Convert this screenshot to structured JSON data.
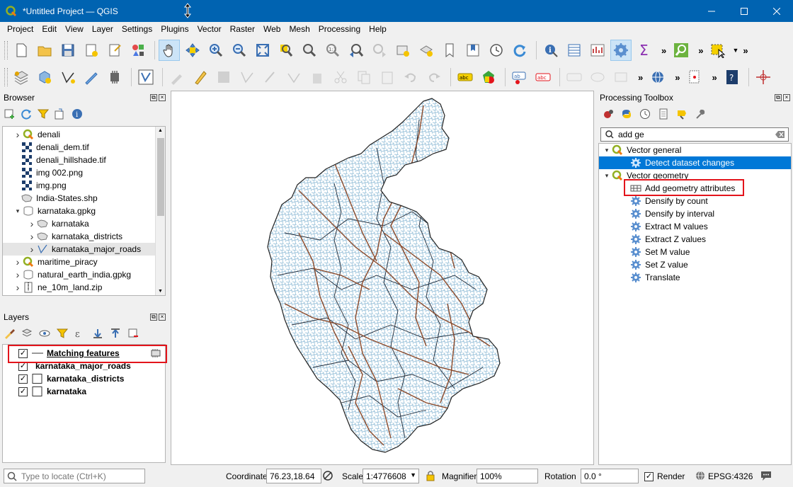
{
  "window": {
    "title": "*Untitled Project — QGIS"
  },
  "menu": [
    "Project",
    "Edit",
    "View",
    "Layer",
    "Settings",
    "Plugins",
    "Vector",
    "Raster",
    "Web",
    "Mesh",
    "Processing",
    "Help"
  ],
  "browser": {
    "title": "Browser",
    "items": [
      {
        "label": "denali",
        "icon": "qgis-project-icon",
        "expand": "right"
      },
      {
        "label": "denali_dem.tif",
        "icon": "raster-icon",
        "expand": ""
      },
      {
        "label": "denali_hillshade.tif",
        "icon": "raster-icon",
        "expand": ""
      },
      {
        "label": "img 002.png",
        "icon": "raster-icon",
        "expand": ""
      },
      {
        "label": "img.png",
        "icon": "raster-icon",
        "expand": ""
      },
      {
        "label": "India-States.shp",
        "icon": "polygon-layer-icon",
        "expand": ""
      },
      {
        "label": "karnataka.gpkg",
        "icon": "database-icon",
        "expand": "down"
      },
      {
        "label": "karnataka",
        "icon": "polygon-layer-icon",
        "expand": "right"
      },
      {
        "label": "karnataka_districts",
        "icon": "polygon-layer-icon",
        "expand": "right"
      },
      {
        "label": "karnataka_major_roads",
        "icon": "line-layer-icon",
        "expand": "right"
      },
      {
        "label": "maritime_piracy",
        "icon": "qgis-project-icon",
        "expand": "right"
      },
      {
        "label": "natural_earth_india.gpkg",
        "icon": "database-icon",
        "expand": "right"
      },
      {
        "label": "ne_10m_land.zip",
        "icon": "zip-icon",
        "expand": "right"
      }
    ]
  },
  "layers": {
    "title": "Layers",
    "items": [
      {
        "label": "Matching features",
        "checked": true
      },
      {
        "label": "karnataka_major_roads",
        "checked": true
      },
      {
        "label": "karnataka_districts",
        "checked": true
      },
      {
        "label": "karnataka",
        "checked": true
      }
    ]
  },
  "toolbox": {
    "title": "Processing Toolbox",
    "search_value": "add ge",
    "groups": [
      {
        "label": "Vector general",
        "items": [
          "Detect dataset changes"
        ]
      },
      {
        "label": "Vector geometry",
        "items": [
          "Add geometry attributes",
          "Densify by count",
          "Densify by interval",
          "Extract M values",
          "Extract Z values",
          "Set M value",
          "Set Z value",
          "Translate"
        ]
      }
    ]
  },
  "status": {
    "locate_placeholder": "Type to locate (Ctrl+K)",
    "coordinate_label": "Coordinate",
    "coordinate_value": "76.23,18.64",
    "scale_label": "Scale",
    "scale_value": "1:4776608",
    "magnifier_label": "Magnifier",
    "magnifier_value": "100%",
    "rotation_label": "Rotation",
    "rotation_value": "0.0 °",
    "render_label": "Render",
    "crs_label": "EPSG:4326"
  },
  "colors": {
    "accent": "#0078d7",
    "highlight": "#e3141b",
    "roads": "#9fc5dc",
    "major_roads": "#8b4a2b"
  }
}
